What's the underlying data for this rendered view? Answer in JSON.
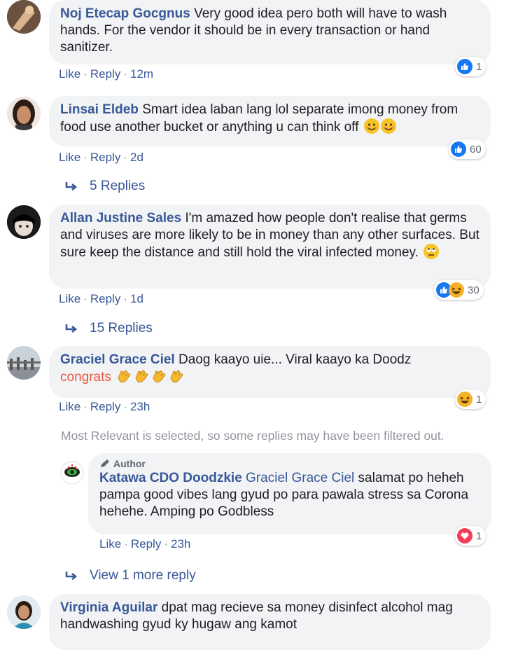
{
  "comments": [
    {
      "author": "Noj Etecap Gocgnus",
      "text": "Very good idea pero both will have to wash hands. For the vendor it should be in every transaction or hand sanitizer.",
      "like": "Like",
      "reply": "Reply",
      "time": "12m",
      "reaction_count": "1"
    },
    {
      "author": "Linsai Eldeb",
      "text": "Smart idea laban lang lol separate imong money from food use another bucket or anything u can think off",
      "like": "Like",
      "reply": "Reply",
      "time": "2d",
      "reaction_count": "60",
      "replies_label": "5 Replies"
    },
    {
      "author": "Allan Justine Sales",
      "text": "I'm amazed how people don't realise that germs and viruses are more likely to be in money than any other surfaces. But sure keep the distance and still hold the viral infected money.",
      "like": "Like",
      "reply": "Reply",
      "time": "1d",
      "reaction_count": "30",
      "replies_label": "15 Replies"
    },
    {
      "author": "Graciel Grace Ciel",
      "text": "Daog kaayo uie... Viral kaayo ka Doodz",
      "highlight": "congrats",
      "like": "Like",
      "reply": "Reply",
      "time": "23h",
      "reaction_count": "1"
    },
    {
      "author": "Virginia Aguilar",
      "text": "dpat mag recieve sa money disinfect alcohol mag handwashing gyud ky hugaw ang kamot"
    }
  ],
  "filter_notice": "Most Relevant is selected, so some replies may have been filtered out.",
  "reply": {
    "badge": "Author",
    "author": "Katawa CDO Doodzkie",
    "mention": "Graciel Grace Ciel",
    "text": "salamat po heheh pampa good vibes lang gyud po para pawala stress sa Corona hehehe. Amping po Godbless",
    "like": "Like",
    "reply": "Reply",
    "time": "23h",
    "reaction_count": "1"
  },
  "view_more": "View 1 more reply",
  "icons": {
    "like": "like-reaction-icon",
    "haha": "haha-reaction-icon",
    "love": "love-reaction-icon",
    "reply_arrow": "reply-arrow-icon",
    "pencil": "pencil-icon"
  },
  "colors": {
    "link": "#385898",
    "like_blue": "#1877f2",
    "bubble": "#f2f3f5",
    "muted": "#90949c",
    "congrats": "#e9573f",
    "love_red": "#f33e58"
  }
}
